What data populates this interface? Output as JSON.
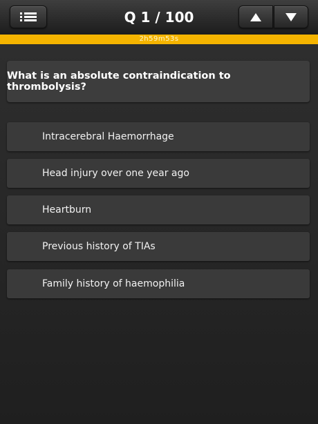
{
  "header": {
    "title": "Q 1 / 100",
    "menu_icon": "list-icon",
    "prev_icon": "triangle-up-icon",
    "next_icon": "triangle-down-icon"
  },
  "timer": {
    "text": "2h59m53s",
    "color": "#f5b400"
  },
  "question": {
    "text": "What is an absolute contraindication to thrombolysis?"
  },
  "answers": [
    {
      "label": "Intracerebral Haemorrhage"
    },
    {
      "label": "Head injury over one year ago"
    },
    {
      "label": "Heartburn"
    },
    {
      "label": "Previous history of TIAs"
    },
    {
      "label": "Family history of haemophilia"
    }
  ]
}
